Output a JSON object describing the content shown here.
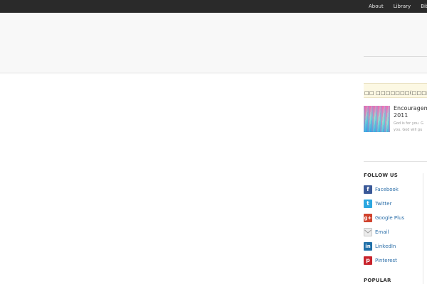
{
  "topnav": {
    "items": [
      "About",
      "Library",
      "Bibl"
    ]
  },
  "ticker": {
    "text": "□□ □□□□□□□(□□□□□□"
  },
  "post": {
    "title_line1": "Encouragem",
    "title_line2": "2011",
    "excerpt_line1": "God is for you. G",
    "excerpt_line2": "you. God will gu"
  },
  "follow": {
    "heading": "FOLLOW US",
    "items": [
      {
        "label": "Facebook",
        "icon": "facebook-icon",
        "color": "#3b5998"
      },
      {
        "label": "Twitter",
        "icon": "twitter-icon",
        "color": "#2ca7e0"
      },
      {
        "label": "Google Plus",
        "icon": "google-plus-icon",
        "color": "#d0422d"
      },
      {
        "label": "Email",
        "icon": "email-icon",
        "color": "#d6d6d6"
      },
      {
        "label": "LinkedIn",
        "icon": "linkedin-icon",
        "color": "#1f6fa8"
      },
      {
        "label": "Pinterest",
        "icon": "pinterest-icon",
        "color": "#c8232c"
      }
    ]
  },
  "popular": {
    "heading": "POPULAR"
  }
}
